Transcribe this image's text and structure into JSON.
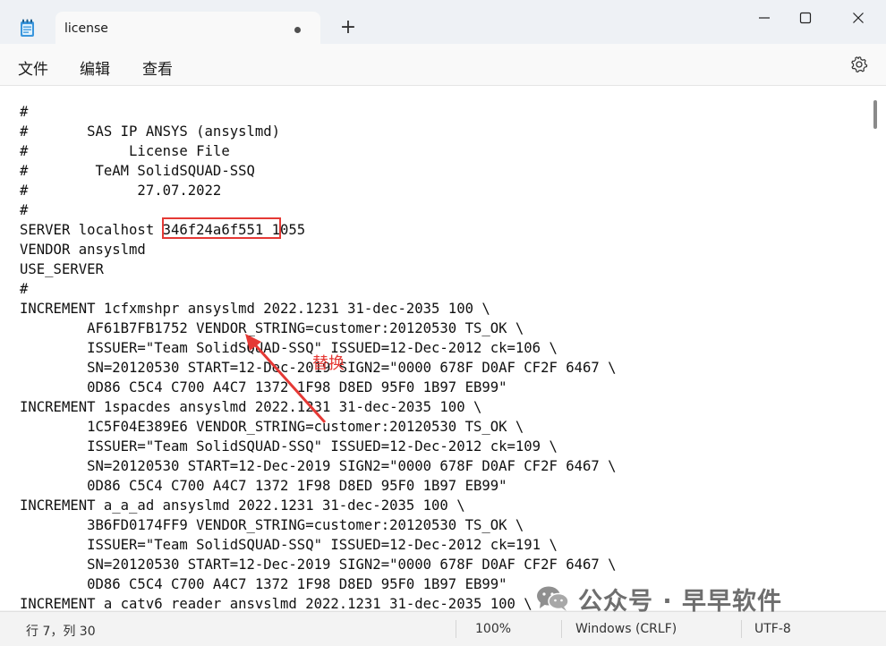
{
  "window": {
    "tab_title": "license",
    "new_tab_label": "+",
    "icons": {
      "app": "notepad-icon",
      "unsaved": "unsaved-dot-icon",
      "minimize": "minimize-icon",
      "maximize": "maximize-icon",
      "close": "close-icon"
    }
  },
  "menu": {
    "items": [
      "文件",
      "编辑",
      "查看"
    ],
    "settings_icon": "gear-icon"
  },
  "editor": {
    "lines": [
      "#",
      "#       SAS IP ANSYS (ansyslmd)",
      "#            License File",
      "#        TeAM SolidSQUAD-SSQ",
      "#             27.07.2022",
      "#",
      "SERVER localhost 346f24a6f551 1055",
      "VENDOR ansyslmd",
      "USE_SERVER",
      "#",
      "INCREMENT 1cfxmshpr ansyslmd 2022.1231 31-dec-2035 100 \\",
      "        AF61B7FB1752 VENDOR_STRING=customer:20120530 TS_OK \\",
      "        ISSUER=\"Team SolidSQUAD-SSQ\" ISSUED=12-Dec-2012 ck=106 \\",
      "        SN=20120530 START=12-Dec-2019 SIGN2=\"0000 678F D0AF CF2F 6467 \\",
      "        0D86 C5C4 C700 A4C7 1372 1F98 D8ED 95F0 1B97 EB99\"",
      "INCREMENT 1spacdes ansyslmd 2022.1231 31-dec-2035 100 \\",
      "        1C5F04E389E6 VENDOR_STRING=customer:20120530 TS_OK \\",
      "        ISSUER=\"Team SolidSQUAD-SSQ\" ISSUED=12-Dec-2012 ck=109 \\",
      "        SN=20120530 START=12-Dec-2019 SIGN2=\"0000 678F D0AF CF2F 6467 \\",
      "        0D86 C5C4 C700 A4C7 1372 1F98 D8ED 95F0 1B97 EB99\"",
      "INCREMENT a_a_ad ansyslmd 2022.1231 31-dec-2035 100 \\",
      "        3B6FD0174FF9 VENDOR_STRING=customer:20120530 TS_OK \\",
      "        ISSUER=\"Team SolidSQUAD-SSQ\" ISSUED=12-Dec-2012 ck=191 \\",
      "        SN=20120530 START=12-Dec-2019 SIGN2=\"0000 678F D0AF CF2F 6467 \\",
      "        0D86 C5C4 C700 A4C7 1372 1F98 D8ED 95F0 1B97 EB99\"",
      "INCREMENT a catv6 reader ansvslmd 2022.1231 31-dec-2035 100 \\"
    ]
  },
  "annotation": {
    "label": "替换",
    "color": "#e53935"
  },
  "status": {
    "position": "行 7，列 30",
    "zoom": "100%",
    "line_ending": "Windows (CRLF)",
    "encoding": "UTF-8"
  },
  "watermark": {
    "text": "公众号 · 早早软件",
    "icon": "wechat-icon"
  }
}
